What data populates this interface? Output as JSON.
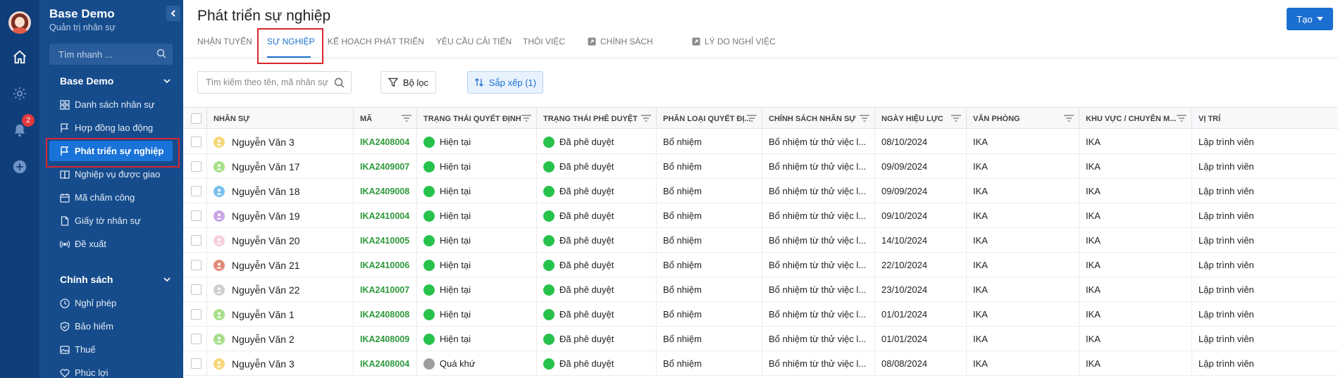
{
  "rail": {
    "notifications_count": "2"
  },
  "sidebar": {
    "app_title": "Base Demo",
    "app_subtitle": "Quản trị nhân sự",
    "search_placeholder": "Tìm nhanh ...",
    "sections": [
      {
        "title": "Base Demo",
        "items": [
          {
            "label": "Danh sách nhân sự",
            "icon": "grid-icon"
          },
          {
            "label": "Hợp đồng lao động",
            "icon": "flag-icon"
          },
          {
            "label": "Phát triển sự nghiệp",
            "icon": "flag-icon",
            "active": true
          },
          {
            "label": "Nghiệp vụ được giao",
            "icon": "book-icon"
          },
          {
            "label": "Mã chấm công",
            "icon": "calendar-icon"
          },
          {
            "label": "Giấy tờ nhân sự",
            "icon": "document-icon"
          },
          {
            "label": "Đề xuất",
            "icon": "broadcast-icon"
          }
        ]
      },
      {
        "title": "Chính sách",
        "items": [
          {
            "label": "Nghỉ phép",
            "icon": "clock-icon"
          },
          {
            "label": "Bảo hiểm",
            "icon": "shield-icon"
          },
          {
            "label": "Thuế",
            "icon": "image-icon"
          },
          {
            "label": "Phúc lợi",
            "icon": "heart-icon"
          }
        ]
      }
    ]
  },
  "header": {
    "title": "Phát triển sự nghiệp",
    "create_label": "Tạo"
  },
  "tabs": [
    {
      "label": "Nhận tuyển"
    },
    {
      "label": "Sự nghiệp",
      "active": true
    },
    {
      "label": "Kế hoạch phát triển"
    },
    {
      "label": "Yêu cầu cải tiến"
    },
    {
      "label": "Thôi việc"
    },
    {
      "label": "Chính sách",
      "icon": "external-link-icon"
    },
    {
      "label": "Lý do nghỉ việc",
      "icon": "external-link-icon"
    }
  ],
  "toolbar": {
    "search_placeholder": "Tìm kiếm theo tên, mã nhân sự",
    "filter_label": "Bộ lọc",
    "sort_label": "Sắp xếp (1)"
  },
  "table": {
    "columns": [
      "Nhân sự",
      "Mã",
      "Trạng thái quyết định",
      "Trạng thái phê duyệt",
      "Phân loại quyết đị...",
      "Chính sách nhân sự",
      "Ngày hiệu lực",
      "Văn phòng",
      "Khu vực / chuyên m...",
      "Vị trí"
    ],
    "rows": [
      {
        "name": "Nguyễn Văn 3",
        "avatar_color": "#f6d77a",
        "code": "IKA2408004",
        "decision": "Hiện tại",
        "decision_color": "#27c24c",
        "approval": "Đã phê duyệt",
        "approval_color": "#27c24c",
        "type": "Bổ nhiệm",
        "policy": "Bổ nhiệm từ thử việc l...",
        "date": "08/10/2024",
        "office": "IKA",
        "area": "IKA",
        "position": "Lập trình viên"
      },
      {
        "name": "Nguyễn Văn 17",
        "avatar_color": "#a7df8a",
        "code": "IKA2409007",
        "decision": "Hiện tại",
        "decision_color": "#27c24c",
        "approval": "Đã phê duyệt",
        "approval_color": "#27c24c",
        "type": "Bổ nhiệm",
        "policy": "Bổ nhiệm từ thử việc l...",
        "date": "09/09/2024",
        "office": "IKA",
        "area": "IKA",
        "position": "Lập trình viên"
      },
      {
        "name": "Nguyễn Văn 18",
        "avatar_color": "#7cc1ef",
        "code": "IKA2409008",
        "decision": "Hiện tại",
        "decision_color": "#27c24c",
        "approval": "Đã phê duyệt",
        "approval_color": "#27c24c",
        "type": "Bổ nhiệm",
        "policy": "Bổ nhiệm từ thử việc l...",
        "date": "09/09/2024",
        "office": "IKA",
        "area": "IKA",
        "position": "Lập trình viên"
      },
      {
        "name": "Nguyễn Văn 19",
        "avatar_color": "#c9a6e6",
        "code": "IKA2410004",
        "decision": "Hiện tại",
        "decision_color": "#27c24c",
        "approval": "Đã phê duyệt",
        "approval_color": "#27c24c",
        "type": "Bổ nhiệm",
        "policy": "Bổ nhiệm từ thử việc l...",
        "date": "09/10/2024",
        "office": "IKA",
        "area": "IKA",
        "position": "Lập trình viên"
      },
      {
        "name": "Nguyễn Văn 20",
        "avatar_color": "#f7cfe0",
        "code": "IKA2410005",
        "decision": "Hiện tại",
        "decision_color": "#27c24c",
        "approval": "Đã phê duyệt",
        "approval_color": "#27c24c",
        "type": "Bổ nhiệm",
        "policy": "Bổ nhiệm từ thử việc l...",
        "date": "14/10/2024",
        "office": "IKA",
        "area": "IKA",
        "position": "Lập trình viên"
      },
      {
        "name": "Nguyễn Văn 21",
        "avatar_color": "#e38b7a",
        "code": "IKA2410006",
        "decision": "Hiện tại",
        "decision_color": "#27c24c",
        "approval": "Đã phê duyệt",
        "approval_color": "#27c24c",
        "type": "Bổ nhiệm",
        "policy": "Bổ nhiệm từ thử việc l...",
        "date": "22/10/2024",
        "office": "IKA",
        "area": "IKA",
        "position": "Lập trình viên"
      },
      {
        "name": "Nguyễn Văn 22",
        "avatar_color": "#cfcfcf",
        "code": "IKA2410007",
        "decision": "Hiện tại",
        "decision_color": "#27c24c",
        "approval": "Đã phê duyệt",
        "approval_color": "#27c24c",
        "type": "Bổ nhiệm",
        "policy": "Bổ nhiệm từ thử việc l...",
        "date": "23/10/2024",
        "office": "IKA",
        "area": "IKA",
        "position": "Lập trình viên"
      },
      {
        "name": "Nguyễn Văn 1",
        "avatar_color": "#a7df8a",
        "code": "IKA2408008",
        "decision": "Hiện tại",
        "decision_color": "#27c24c",
        "approval": "Đã phê duyệt",
        "approval_color": "#27c24c",
        "type": "Bổ nhiệm",
        "policy": "Bổ nhiệm từ thử việc l...",
        "date": "01/01/2024",
        "office": "IKA",
        "area": "IKA",
        "position": "Lập trình viên"
      },
      {
        "name": "Nguyễn Văn 2",
        "avatar_color": "#a7df8a",
        "code": "IKA2408009",
        "decision": "Hiện tại",
        "decision_color": "#27c24c",
        "approval": "Đã phê duyệt",
        "approval_color": "#27c24c",
        "type": "Bổ nhiệm",
        "policy": "Bổ nhiệm từ thử việc l...",
        "date": "01/01/2024",
        "office": "IKA",
        "area": "IKA",
        "position": "Lập trình viên",
        "hover_edit": true
      },
      {
        "name": "Nguyễn Văn 3",
        "avatar_color": "#f6d77a",
        "code": "IKA2408004",
        "decision": "Quá khứ",
        "decision_color": "#9e9e9e",
        "approval": "Đã phê duyệt",
        "approval_color": "#27c24c",
        "type": "Bổ nhiệm",
        "policy": "Bổ nhiệm từ thử việc l...",
        "date": "08/08/2024",
        "office": "IKA",
        "area": "IKA",
        "position": "Lập trình viên"
      }
    ]
  },
  "colors": {
    "rail": "#0f3e7a",
    "sidebar": "#164c8c",
    "accent": "#1a6fd0",
    "highlight_frame": "#d8262e"
  }
}
